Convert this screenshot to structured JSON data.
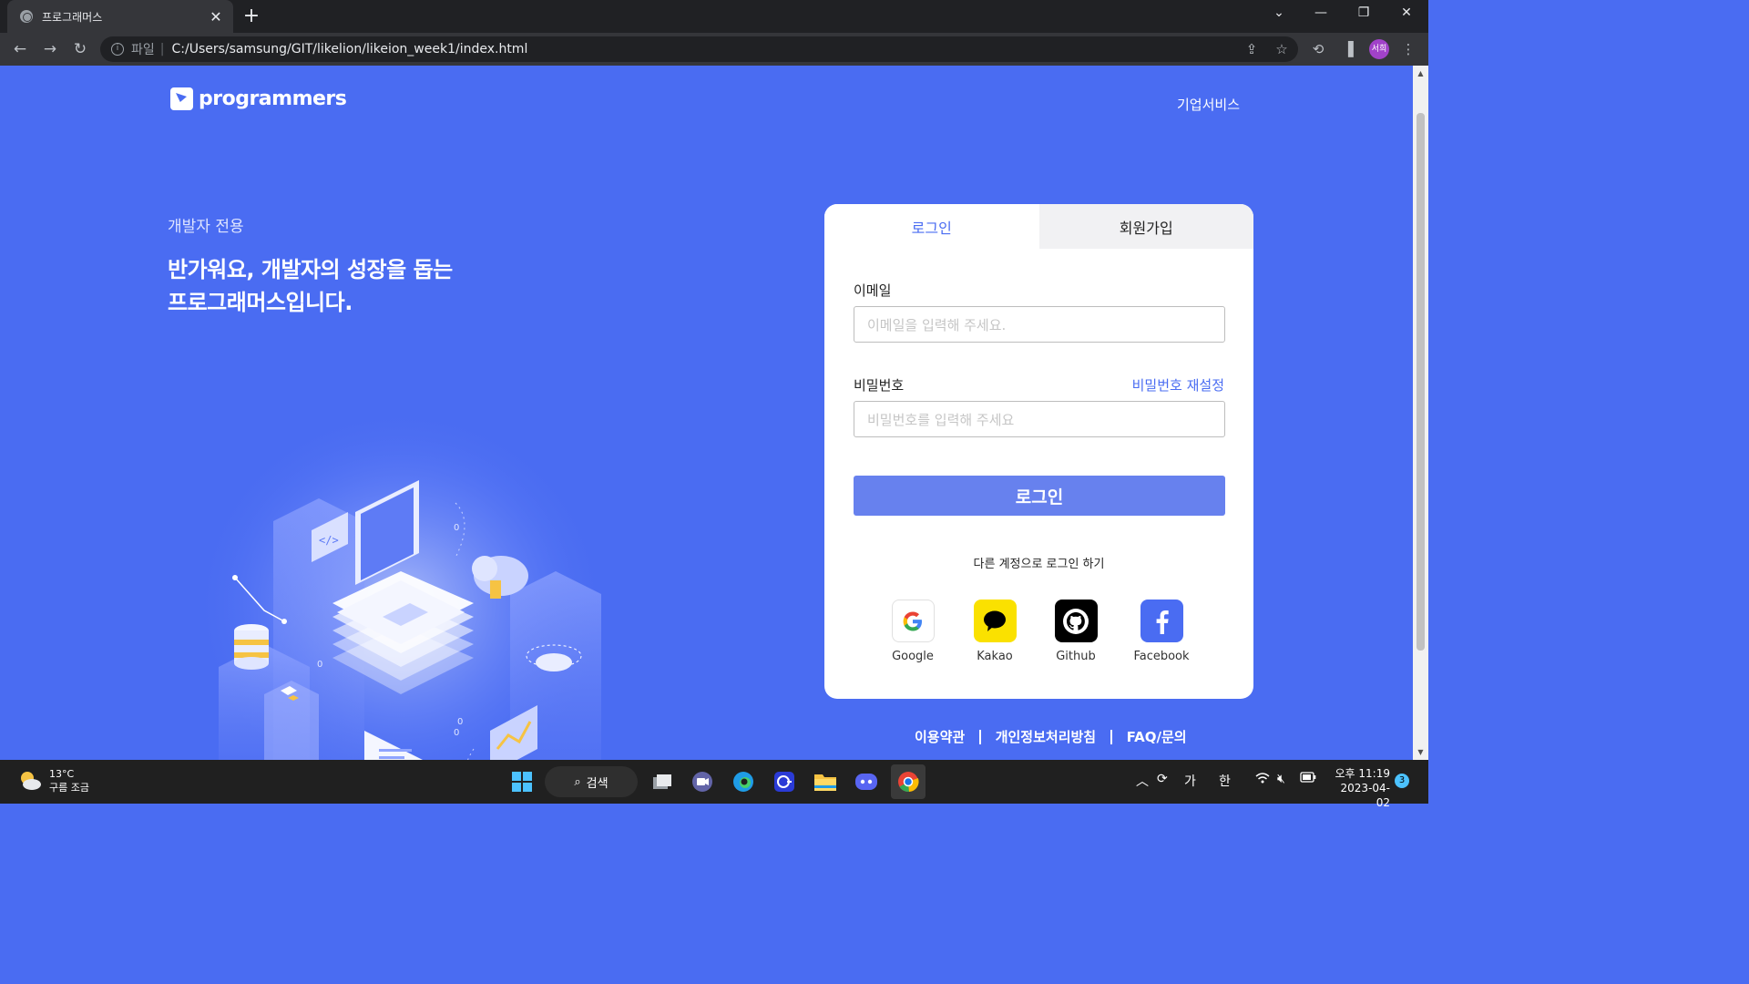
{
  "browser": {
    "tab_title": "프로그래머스",
    "tab_close": "✕",
    "new_tab": "+",
    "scheme_label": "파일",
    "url": "C:/Users/samsung/GIT/likelion/likeion_week1/index.html",
    "profile_initials": "서희"
  },
  "header": {
    "logo_text": "programmers",
    "biz_link": "기업서비스"
  },
  "hero": {
    "subtitle": "개발자 전용",
    "headline_line1": "반가워요, 개발자의 성장을 돕는",
    "headline_line2": "프로그래머스입니다."
  },
  "login_card": {
    "tab_login": "로그인",
    "tab_signup": "회원가입",
    "email_label": "이메일",
    "email_placeholder": "이메일을 입력해 주세요.",
    "password_label": "비밀번호",
    "password_reset": "비밀번호 재설정",
    "password_placeholder": "비밀번호를 입력해 주세요",
    "login_button": "로그인",
    "other_login": "다른 계정으로 로그인 하기",
    "socials": [
      {
        "name": "Google",
        "icon": "google-icon"
      },
      {
        "name": "Kakao",
        "icon": "kakao-icon"
      },
      {
        "name": "Github",
        "icon": "github-icon"
      },
      {
        "name": "Facebook",
        "icon": "facebook-icon"
      }
    ]
  },
  "footer": {
    "terms": "이용약관",
    "privacy": "개인정보처리방침",
    "faq": "FAQ/문의"
  },
  "taskbar": {
    "weather_temp": "13°C",
    "weather_desc": "구름 조금",
    "search_label": "검색",
    "ime_1": "가",
    "ime_2": "한",
    "clock_time": "오후 11:19",
    "clock_date": "2023-04-02",
    "notification_count": "3"
  },
  "colors": {
    "brand_blue": "#4a6cf2",
    "login_button": "#6781ee",
    "kakao_yellow": "#fae100",
    "facebook_blue": "#4a6cf2"
  }
}
